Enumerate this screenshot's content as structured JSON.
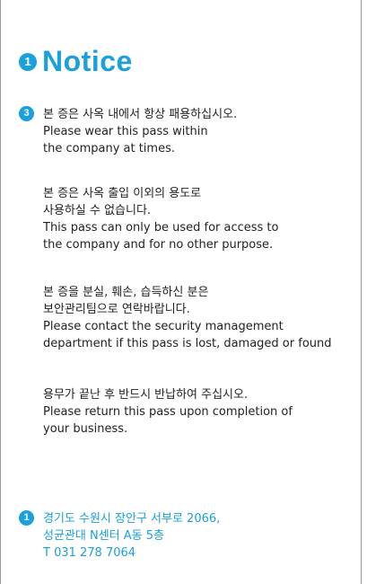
{
  "colors": {
    "accent": "#1aa0dc",
    "text": "#222222",
    "border": "#9a9a9a"
  },
  "title_badge": "1",
  "title": "Notice",
  "first_block_badge": "3",
  "blocks": [
    {
      "lines": [
        "본 증은 사옥 내에서 항상 패용하십시오.",
        "Please wear this pass within",
        "the company at times."
      ]
    },
    {
      "lines": [
        "본 증은 사옥 출입 이외의 용도로",
        "사용하실 수 없습니다.",
        "This pass can only be used for access to",
        "the company and for no other purpose."
      ]
    },
    {
      "lines": [
        "본 증을 분실, 훼손, 습득하신 분은",
        "보안관리팀으로 연락바랍니다.",
        "Please contact the security management",
        "department if this pass is lost, damaged or found"
      ]
    },
    {
      "lines": [
        "용무가 끝난 후 반드시 반납하여 주십시오.",
        "Please return this pass upon completion of",
        "your business."
      ]
    }
  ],
  "address_badge": "1",
  "address": {
    "lines": [
      "경기도 수원시 장안구 서부로 2066,",
      "성균관대 N센터 A동 5층",
      "T 031 278 7064"
    ]
  }
}
